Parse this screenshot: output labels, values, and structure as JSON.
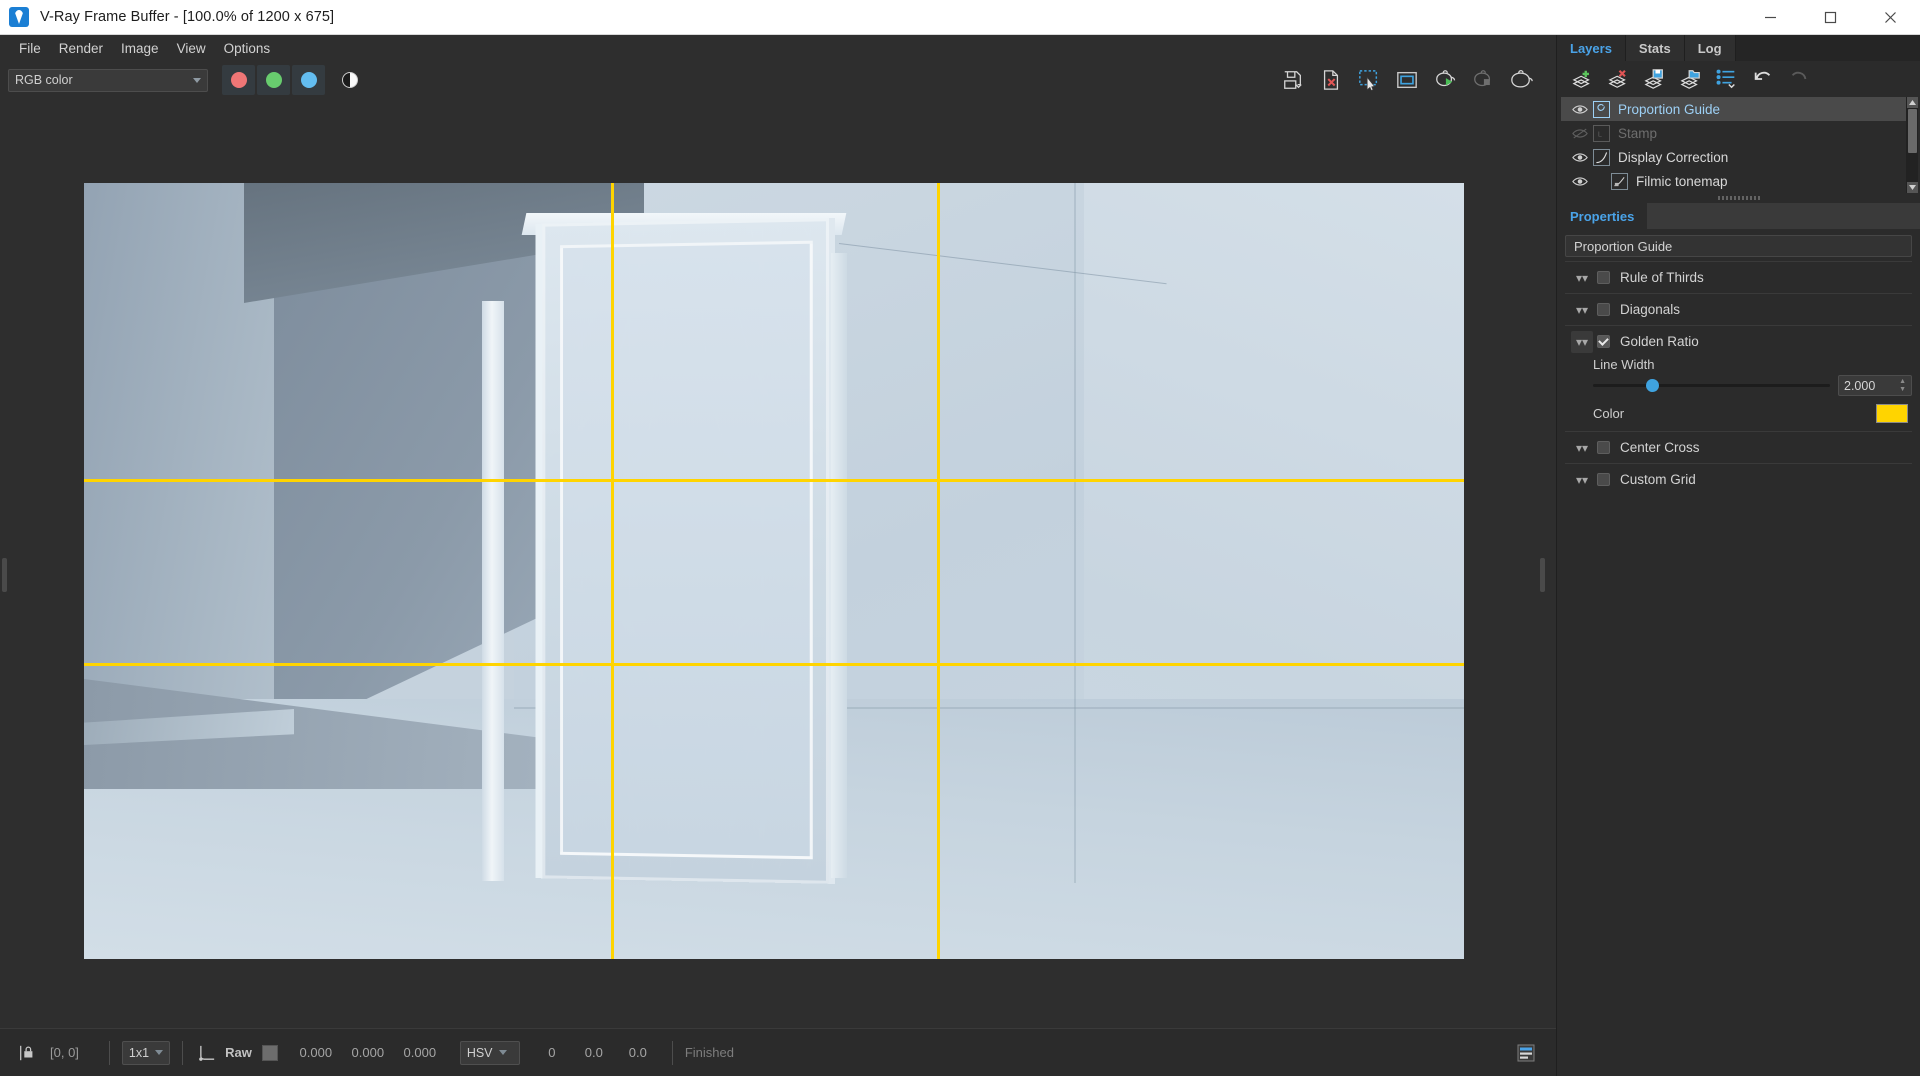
{
  "window": {
    "title": "V-Ray Frame Buffer - [100.0% of 1200 x 675]",
    "logo_icon": "vray-logo-icon",
    "minimize_label": "—",
    "maximize_label": "☐",
    "close_label": "✕"
  },
  "menubar": {
    "items": [
      {
        "label": "File"
      },
      {
        "label": "Render"
      },
      {
        "label": "Image"
      },
      {
        "label": "View"
      },
      {
        "label": "Options"
      }
    ]
  },
  "toolbar": {
    "channel_select": {
      "value": "RGB color",
      "icon": "chevron-down-icon"
    },
    "channel_buttons": [
      {
        "name": "red-channel-button",
        "color": "#ef7676"
      },
      {
        "name": "green-channel-button",
        "color": "#68cc6e"
      },
      {
        "name": "blue-channel-button",
        "color": "#63bdf0"
      },
      {
        "name": "alpha-channel-button",
        "color": "#ffffff"
      }
    ],
    "right_icons": [
      {
        "name": "save-image-icon",
        "title": "Save current channel"
      },
      {
        "name": "clear-image-icon",
        "title": "Clear image"
      },
      {
        "name": "region-render-icon",
        "title": "Render region"
      },
      {
        "name": "view-frame-icon",
        "title": "Track mouse / frame"
      },
      {
        "name": "start-render-icon",
        "title": "Start render"
      },
      {
        "name": "stop-render-icon",
        "title": "Stop render"
      },
      {
        "name": "render-last-icon",
        "title": "Render last"
      }
    ]
  },
  "canvas": {
    "image_title": "interior-room-render",
    "guides": {
      "type": "Golden Ratio",
      "color": "#ffd400",
      "line_width": 2.0,
      "vertical_fractions": [
        0.382,
        0.618
      ],
      "horizontal_fractions": [
        0.382,
        0.618
      ]
    }
  },
  "statusbar": {
    "lock_icon": "pixel-lock-icon",
    "coordinates": "[0, 0]",
    "sample_size": "1x1",
    "curve_icon": "color-curve-icon",
    "raw_label": "Raw",
    "raw_swatch": "#6d6d6d",
    "raw_values": [
      "0.000",
      "0.000",
      "0.000"
    ],
    "color_space": "HSV",
    "hsv_values": [
      "0",
      "0.0",
      "0.0"
    ],
    "render_status": "Finished",
    "layout_toggle_icon": "panel-layout-icon"
  },
  "dock": {
    "tabs": [
      {
        "label": "Layers",
        "active": true
      },
      {
        "label": "Stats",
        "active": false
      },
      {
        "label": "Log",
        "active": false
      }
    ],
    "layer_tools": [
      {
        "name": "add-layer-icon",
        "title": "Add layer"
      },
      {
        "name": "delete-layer-icon",
        "title": "Delete layer"
      },
      {
        "name": "save-layers-icon",
        "title": "Save layer setup"
      },
      {
        "name": "load-layers-icon",
        "title": "Load layer setup"
      },
      {
        "name": "layer-presets-icon",
        "title": "Layer presets"
      },
      {
        "name": "undo-icon",
        "title": "Undo"
      },
      {
        "name": "redo-icon",
        "title": "Redo"
      }
    ],
    "layers": [
      {
        "label": "Proportion Guide",
        "icon": "proportion-guide-icon",
        "visible": true,
        "selected": true,
        "enabled": true,
        "indented": false
      },
      {
        "label": "Stamp",
        "icon": "stamp-icon",
        "visible": false,
        "selected": false,
        "enabled": false,
        "indented": false
      },
      {
        "label": "Display Correction",
        "icon": "display-correction-icon",
        "visible": true,
        "selected": false,
        "enabled": true,
        "indented": false
      },
      {
        "label": "Filmic tonemap",
        "icon": "filmic-tonemap-icon",
        "visible": true,
        "selected": false,
        "enabled": true,
        "indented": true
      }
    ],
    "properties": {
      "title": "Properties",
      "name_value": "Proportion Guide",
      "sections": [
        {
          "label": "Rule of Thirds",
          "checked": false,
          "expanded": false
        },
        {
          "label": "Diagonals",
          "checked": false,
          "expanded": false
        },
        {
          "label": "Golden Ratio",
          "checked": true,
          "expanded": true,
          "line_width_label": "Line Width",
          "line_width_value": "2.000",
          "line_width_percent": 25,
          "color_label": "Color",
          "color_value": "#ffd400"
        },
        {
          "label": "Center Cross",
          "checked": false,
          "expanded": false
        },
        {
          "label": "Custom Grid",
          "checked": false,
          "expanded": false
        }
      ]
    }
  }
}
